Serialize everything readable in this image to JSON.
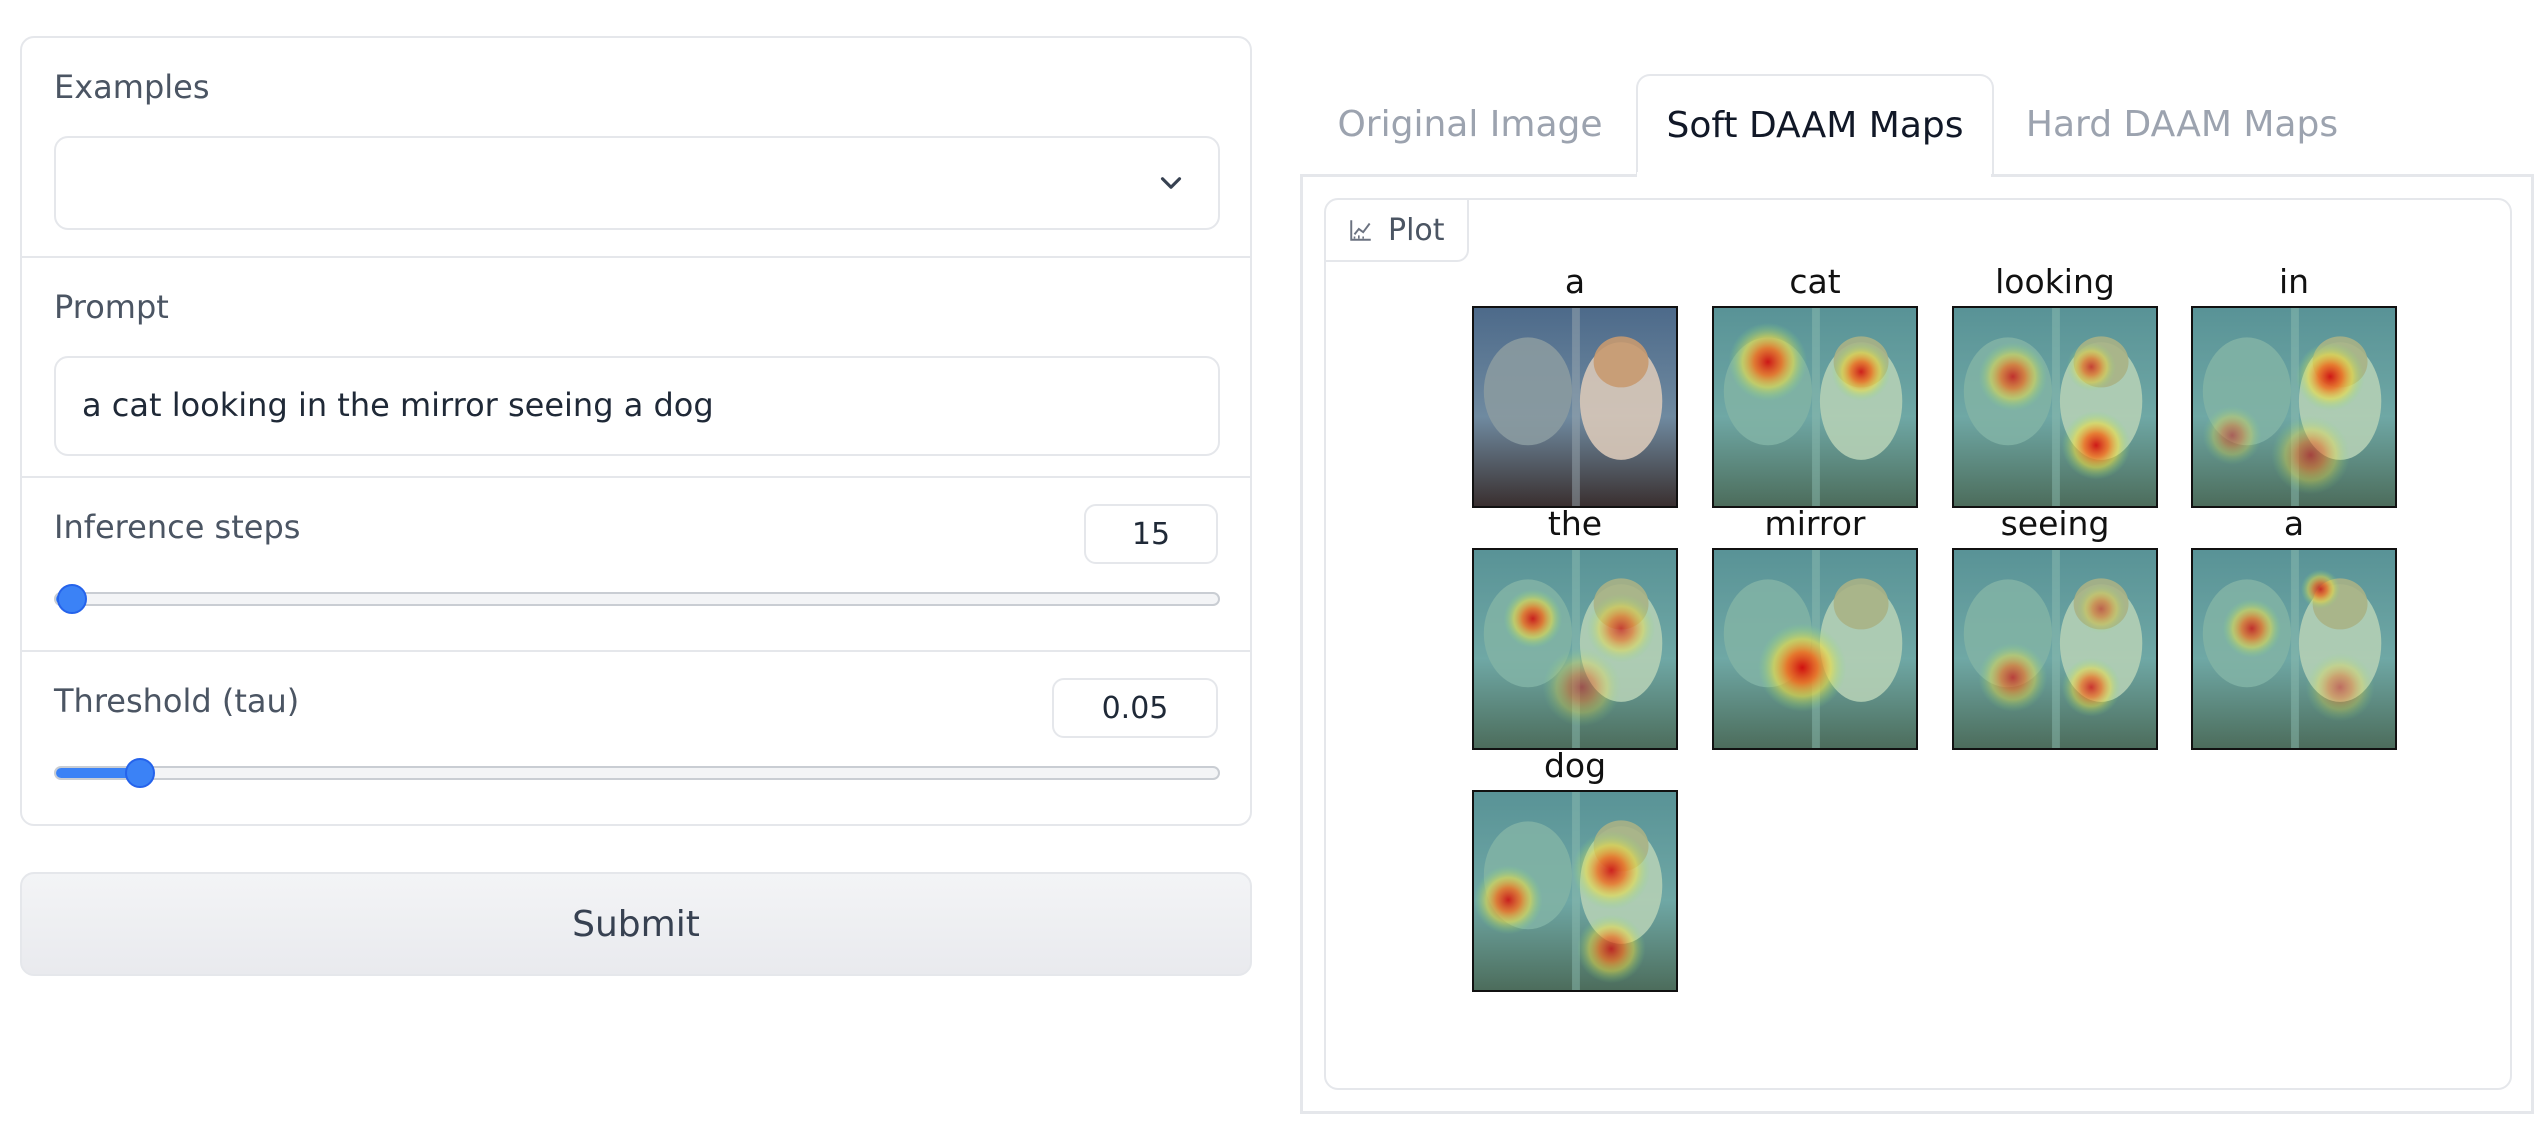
{
  "form": {
    "examples": {
      "label": "Examples",
      "value": ""
    },
    "prompt": {
      "label": "Prompt",
      "value": "a cat looking in the mirror seeing a dog"
    },
    "inference_steps": {
      "label": "Inference steps",
      "value": "15",
      "slider_fraction": 0.0
    },
    "threshold": {
      "label": "Threshold (tau)",
      "value": "0.05",
      "slider_fraction": 0.06
    },
    "submit_label": "Submit"
  },
  "tabs": [
    {
      "label": "Original Image",
      "active": false
    },
    {
      "label": "Soft DAAM Maps",
      "active": true
    },
    {
      "label": "Hard DAAM Maps",
      "active": false
    }
  ],
  "plot": {
    "badge_label": "Plot",
    "maps": [
      {
        "word": "a"
      },
      {
        "word": "cat"
      },
      {
        "word": "looking"
      },
      {
        "word": "in"
      },
      {
        "word": "the"
      },
      {
        "word": "mirror"
      },
      {
        "word": "seeing"
      },
      {
        "word": "a"
      },
      {
        "word": "dog"
      }
    ]
  },
  "colors": {
    "accent": "#3b82f6",
    "border": "#e5e7eb",
    "muted_text": "#9ca3af"
  }
}
